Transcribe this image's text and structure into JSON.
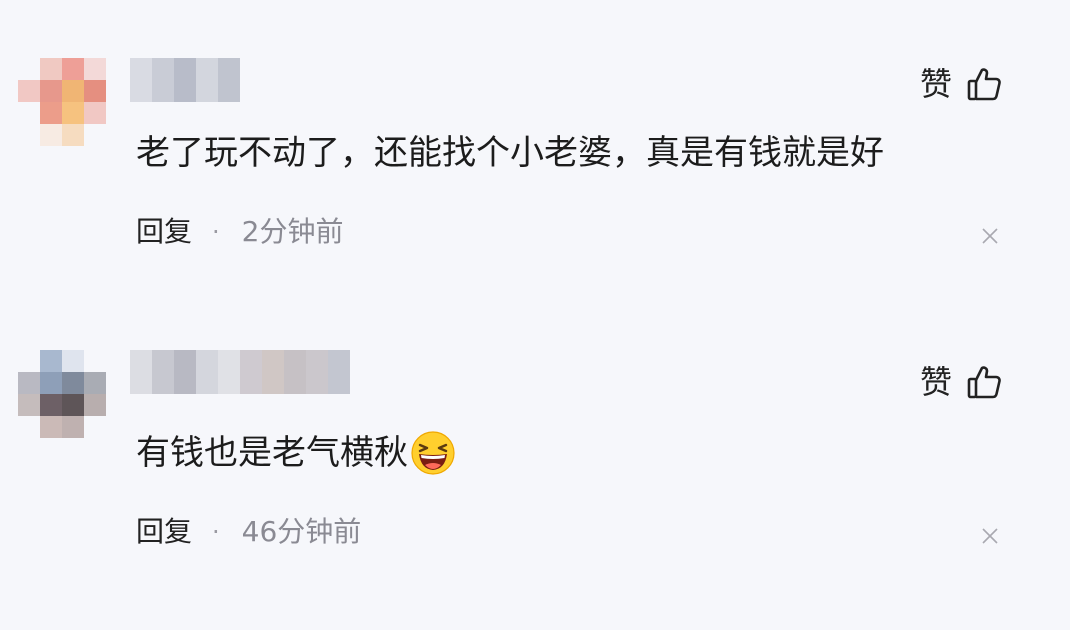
{
  "comments": [
    {
      "like_label": "赞",
      "text": "老了玩不动了，还能找个小老婆，真是有钱就是好",
      "reply_label": "回复",
      "separator": "·",
      "time": "2分钟前"
    },
    {
      "like_label": "赞",
      "text": "有钱也是老气横秋",
      "emoji": "laughing-emoji-icon",
      "reply_label": "回复",
      "separator": "·",
      "time": "46分钟前"
    }
  ],
  "icons": {
    "like": "thumbs-up-icon",
    "close": "close-icon"
  },
  "colors": {
    "background": "#f6f7fb",
    "text": "#1c1c1c",
    "muted": "#8a8a93"
  }
}
